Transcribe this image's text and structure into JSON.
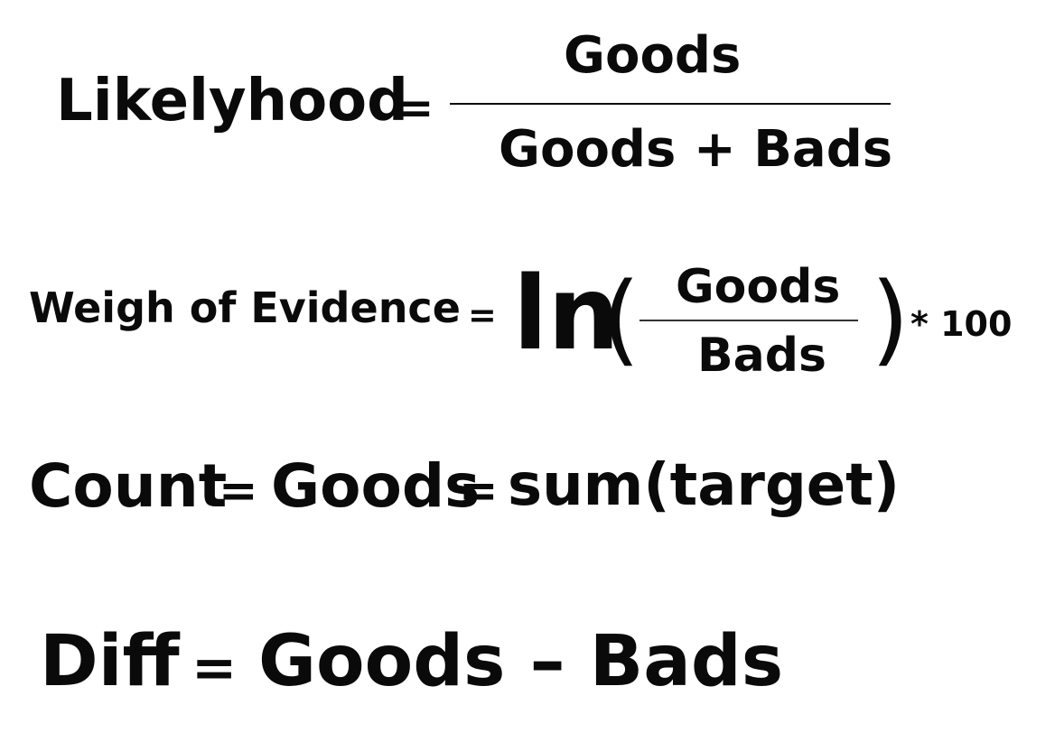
{
  "colors": {
    "background": "#ffffff",
    "ink": "#0a0a0a"
  },
  "formulas": {
    "likelyhood": {
      "lhs": "Likelyhood",
      "equals": "=",
      "numerator": "Goods",
      "denominator": "Goods + Bads"
    },
    "weight_of_evidence": {
      "lhs": "Weigh of Evidence",
      "equals": "=",
      "ln": "ln",
      "open_paren": "(",
      "numerator": "Goods",
      "denominator": "Bads",
      "close_paren": ")",
      "multiplier": "* 100"
    },
    "count": {
      "lhs": "Count",
      "equals_1": "=",
      "middle": "Goods",
      "equals_2": "=",
      "rhs": "sum(target)"
    },
    "diff": {
      "lhs": "Diff",
      "equals": "=",
      "rhs": "Goods – Bads"
    }
  }
}
